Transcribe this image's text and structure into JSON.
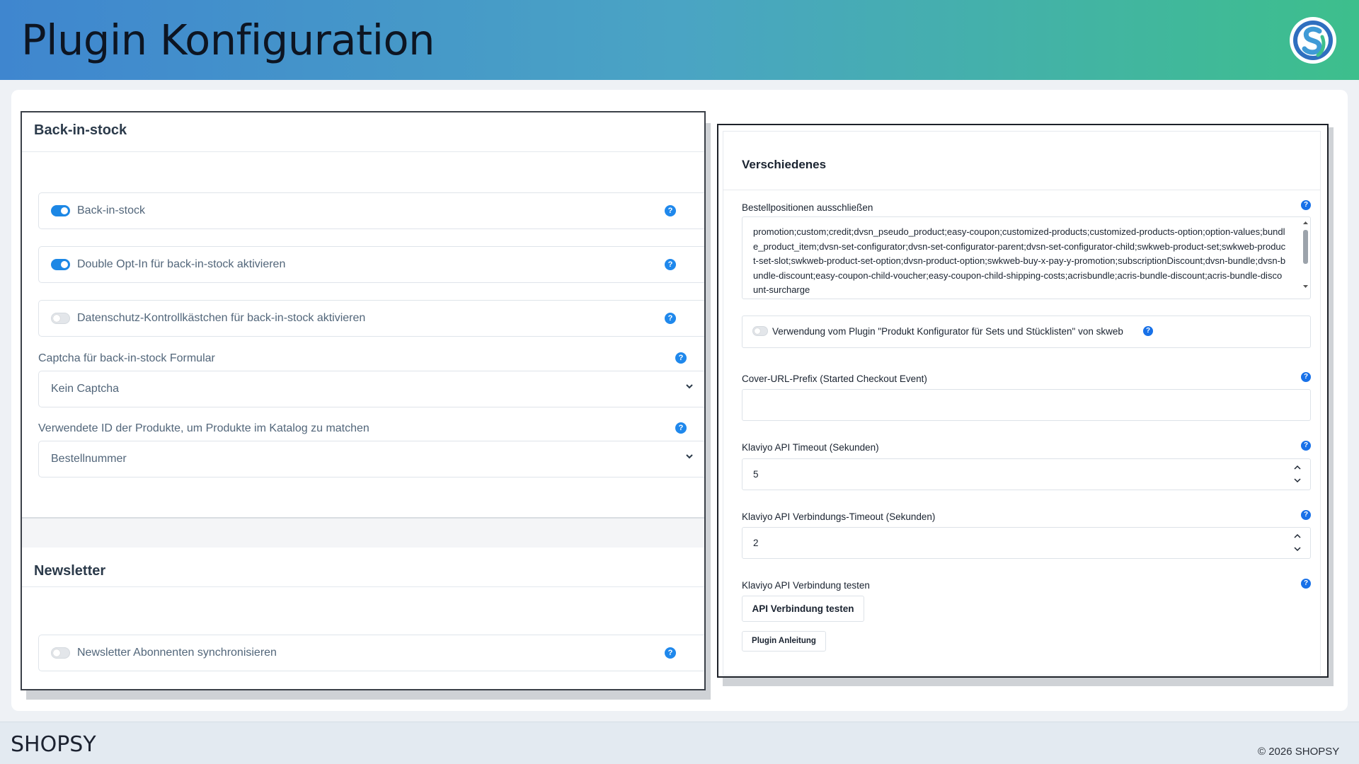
{
  "banner": {
    "title": "Plugin Konfiguration",
    "logo_icon": "shopsy-logo-icon"
  },
  "left": {
    "section1_title": "Back-in-stock",
    "toggles": [
      {
        "label": "Back-in-stock",
        "on": true
      },
      {
        "label": "Double Opt-In für back-in-stock aktivieren",
        "on": true
      },
      {
        "label": "Datenschutz-Kontrollkästchen für back-in-stock aktivieren",
        "on": false
      }
    ],
    "captcha": {
      "label": "Captcha für back-in-stock Formular",
      "value": "Kein Captcha"
    },
    "product_id": {
      "label": "Verwendete ID der Produkte, um Produkte im Katalog zu matchen",
      "value": "Bestellnummer"
    },
    "section2_title": "Newsletter",
    "newsletter_toggle": {
      "label": "Newsletter Abonnenten synchronisieren",
      "on": false
    }
  },
  "right": {
    "title": "Verschiedenes",
    "exclude": {
      "label": "Bestellpositionen ausschließen",
      "value": "promotion;custom;credit;dvsn_pseudo_product;easy-coupon;customized-products;customized-products-option;option-values;bundle_product_item;dvsn-set-configurator;dvsn-set-configurator-parent;dvsn-set-configurator-child;swkweb-product-set;swkweb-product-set-slot;swkweb-product-set-option;dvsn-product-option;swkweb-buy-x-pay-y-promotion;subscriptionDiscount;dvsn-bundle;dvsn-bundle-discount;easy-coupon-child-voucher;easy-coupon-child-shipping-costs;acrisbundle;acris-bundle-discount;acris-bundle-discount-surcharge"
    },
    "skweb_toggle": {
      "label": "Verwendung vom Plugin \"Produkt Konfigurator für Sets und Stücklisten\" von skweb",
      "on": false
    },
    "cover_url": {
      "label": "Cover-URL-Prefix (Started Checkout Event)",
      "value": ""
    },
    "timeout": {
      "label": "Klaviyo API Timeout (Sekunden)",
      "value": "5"
    },
    "conn_timeout": {
      "label": "Klaviyo API Verbindungs-Timeout (Sekunden)",
      "value": "2"
    },
    "test": {
      "label": "Klaviyo API Verbindung testen",
      "button": "API Verbindung testen"
    },
    "manual_button": "Plugin Anleitung"
  },
  "footer": {
    "brand": "SHOPSY",
    "copyright": "© 2026 SHOPSY"
  },
  "help_glyph": "?"
}
